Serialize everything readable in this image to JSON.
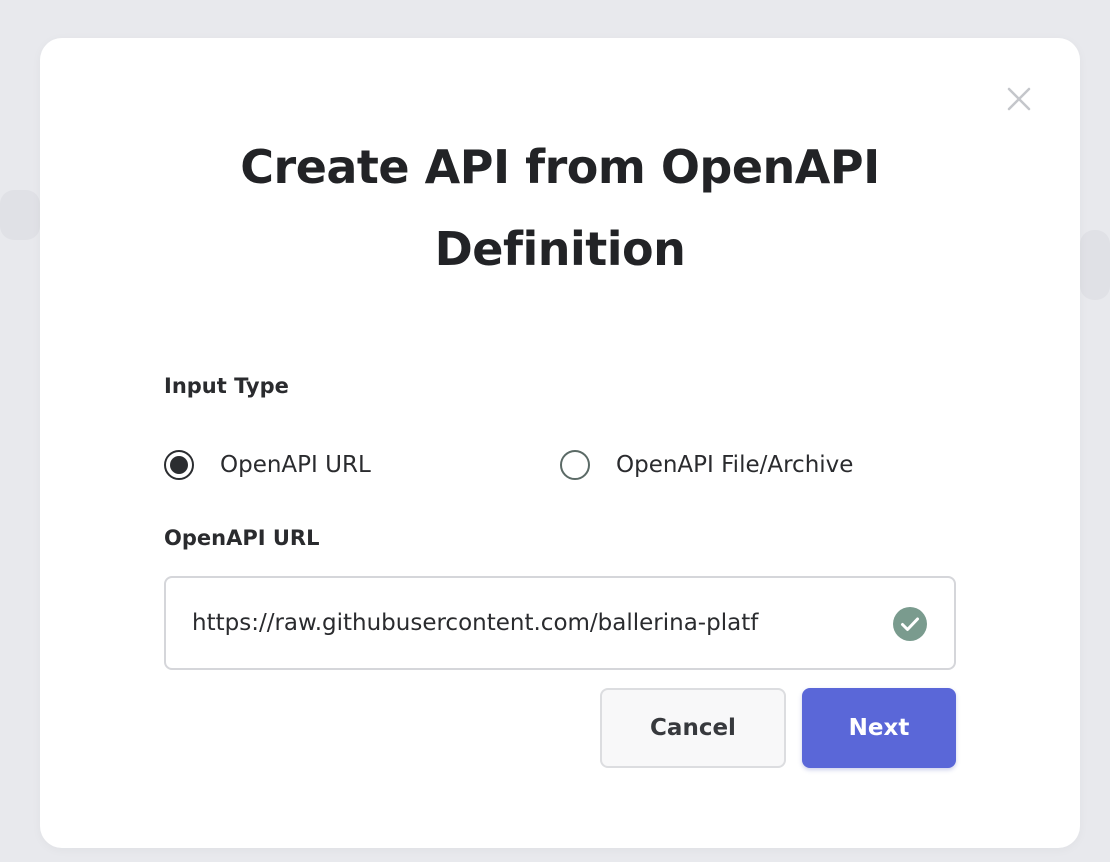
{
  "dialog": {
    "title": "Create API from OpenAPI Definition",
    "close_icon": "close-icon"
  },
  "input_type": {
    "label": "Input Type",
    "options": [
      {
        "label": "OpenAPI URL",
        "selected": true
      },
      {
        "label": "OpenAPI File/Archive",
        "selected": false
      }
    ]
  },
  "url_field": {
    "label": "OpenAPI URL",
    "value": "https://raw.githubusercontent.com/ballerina-platf",
    "status_icon": "check-circle-icon",
    "status_color": "#7a9b8e"
  },
  "actions": {
    "cancel_label": "Cancel",
    "next_label": "Next",
    "accent_color": "#5a67d8"
  }
}
